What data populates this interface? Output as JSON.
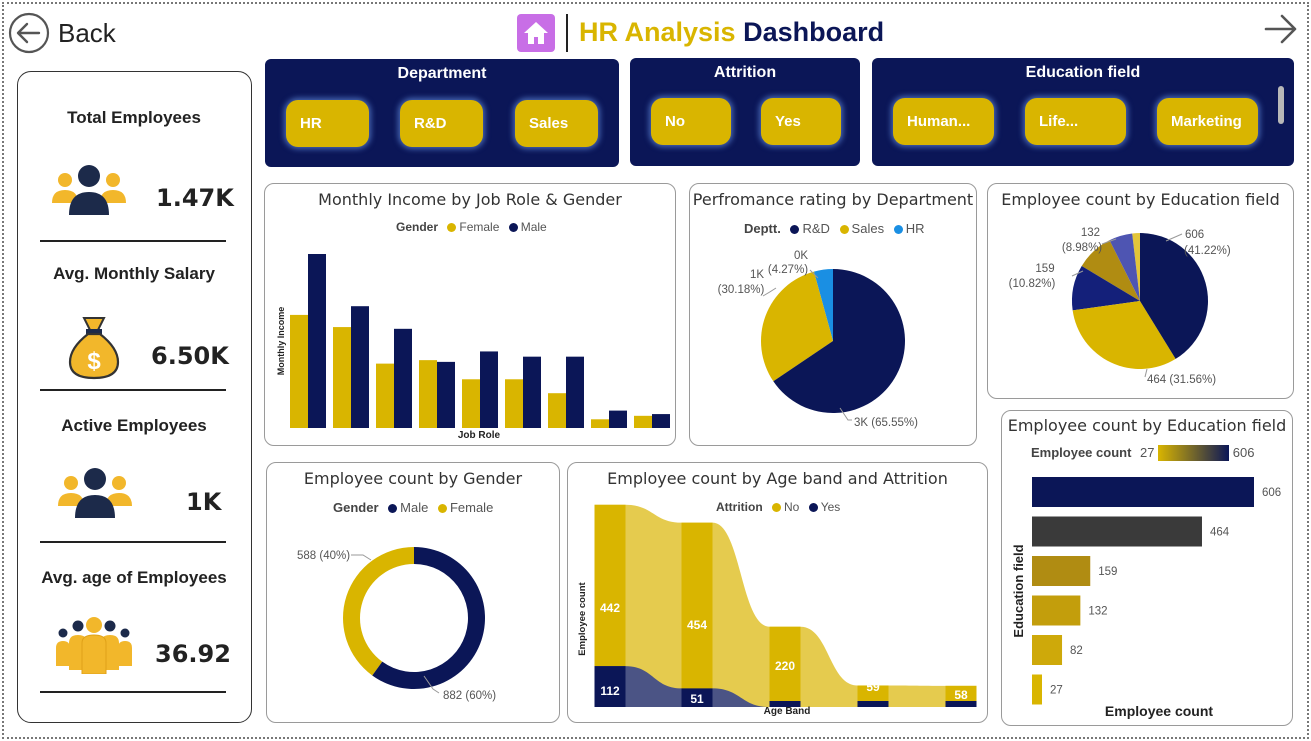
{
  "nav": {
    "back_label": "Back"
  },
  "header": {
    "title_part1": "HR Analysis",
    "title_part2": "Dashboard"
  },
  "colors": {
    "navy": "#0b1657",
    "gold": "#d9b500",
    "gray": "#3a3a3a",
    "blue": "#1a8fe3"
  },
  "kpis": [
    {
      "label": "Total Employees",
      "value": "1.47K",
      "icon": "team-icon"
    },
    {
      "label": "Avg. Monthly Salary",
      "value": "6.50K",
      "icon": "money-bag-icon"
    },
    {
      "label": "Active Employees",
      "value": "1K",
      "icon": "team-icon"
    },
    {
      "label": "Avg. age of Employees",
      "value": "36.92",
      "icon": "group-icon"
    }
  ],
  "slicers": {
    "department": {
      "title": "Department",
      "options": [
        "HR",
        "R&D",
        "Sales"
      ]
    },
    "attrition": {
      "title": "Attrition",
      "options": [
        "No",
        "Yes"
      ]
    },
    "education": {
      "title": "Education field",
      "options": [
        "Human...",
        "Life...",
        "Marketing"
      ]
    }
  },
  "charts": {
    "income": {
      "title": "Monthly Income by Job Role & Gender",
      "legend_title": "Gender",
      "legend": [
        "Female",
        "Male"
      ],
      "xlabel": "Job Role",
      "ylabel": "Monthly Income"
    },
    "performance": {
      "title": "Perfromance rating by Department",
      "legend_title": "Deptt.",
      "legend": [
        "R&D",
        "Sales",
        "HR"
      ],
      "labels": {
        "hr_a": "0K",
        "hr_b": "(4.27%)",
        "sales_a": "1K",
        "sales_b": "(30.18%)",
        "rd": "3K (65.55%)"
      }
    },
    "education_pie": {
      "title": "Employee count by Education field",
      "labels": {
        "a1": "606",
        "a2": "(41.22%)",
        "b": "464 (31.56%)",
        "c1": "159",
        "c2": "(10.82%)",
        "d1": "132",
        "d2": "(8.98%)"
      }
    },
    "gender": {
      "title": "Employee count by Gender",
      "legend_title": "Gender",
      "legend": [
        "Male",
        "Female"
      ],
      "labels": {
        "female": "588 (40%)",
        "male": "882 (60%)"
      }
    },
    "ageband": {
      "title": "Employee count by Age band and Attrition",
      "legend_title": "Attrition",
      "legend": [
        "No",
        "Yes"
      ],
      "xlabel": "Age Band",
      "ylabel": "Employee count",
      "labels": {
        "no1": "442",
        "yes1": "112",
        "no2": "454",
        "yes2": "51",
        "no3": "220",
        "no4": "59",
        "no5": "58"
      }
    },
    "education_bar": {
      "title": "Employee count by Education field",
      "legend_title": "Employee count",
      "legend_min": "27",
      "legend_max": "606",
      "xlabel": "Employee count",
      "ylabel": "Education field"
    }
  },
  "chart_data": [
    {
      "type": "bar",
      "title": "Monthly Income by Job Role & Gender",
      "xlabel": "Job Role",
      "ylabel": "Monthly Income",
      "categories": [
        "",
        "",
        "",
        "",
        "",
        "",
        "",
        "",
        ""
      ],
      "series": [
        {
          "name": "Female",
          "values": [
            0.65,
            0.58,
            0.37,
            0.39,
            0.28,
            0.28,
            0.2,
            0.05,
            0.07
          ]
        },
        {
          "name": "Male",
          "values": [
            1.0,
            0.7,
            0.57,
            0.38,
            0.44,
            0.41,
            0.41,
            0.1,
            0.08
          ]
        }
      ]
    },
    {
      "type": "pie",
      "title": "Perfromance rating by Department",
      "categories": [
        "R&D",
        "Sales",
        "HR"
      ],
      "values": [
        65.55,
        30.18,
        4.27
      ],
      "labels": [
        "3K (65.55%)",
        "1K (30.18%)",
        "0K (4.27%)"
      ]
    },
    {
      "type": "pie",
      "title": "Employee count by Education field",
      "values": [
        606,
        464,
        159,
        132,
        82,
        27
      ],
      "percents": [
        41.22,
        31.56,
        10.82,
        8.98
      ]
    },
    {
      "type": "pie",
      "title": "Employee count by Gender",
      "categories": [
        "Male",
        "Female"
      ],
      "values": [
        882,
        588
      ],
      "percents": [
        60,
        40
      ]
    },
    {
      "type": "area",
      "title": "Employee count by Age band and Attrition",
      "xlabel": "Age Band",
      "ylabel": "Employee count",
      "series": [
        {
          "name": "No",
          "values": [
            442,
            454,
            220,
            59,
            58
          ]
        },
        {
          "name": "Yes",
          "values": [
            112,
            51,
            0,
            0,
            0
          ]
        }
      ]
    },
    {
      "type": "bar",
      "title": "Employee count by Education field",
      "xlabel": "Employee count",
      "ylabel": "Education field",
      "values": [
        606,
        464,
        159,
        132,
        82,
        27
      ],
      "xlim": [
        27,
        606
      ]
    }
  ]
}
